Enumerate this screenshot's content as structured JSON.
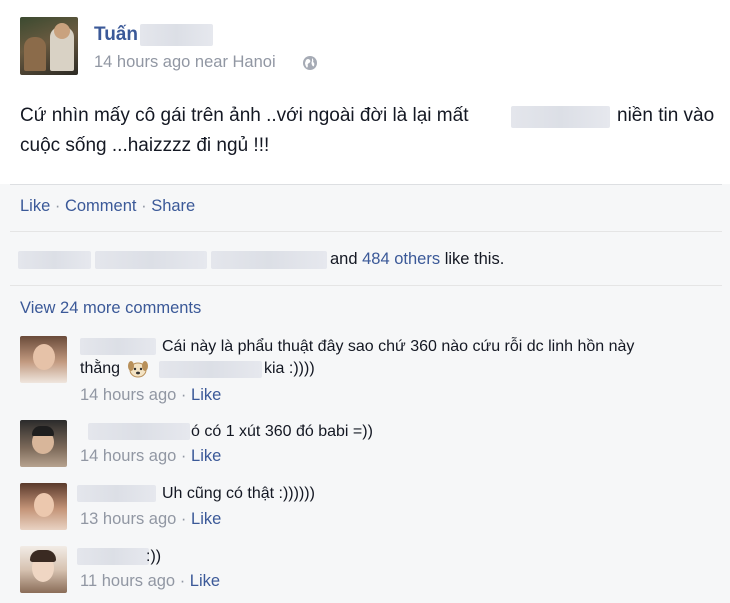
{
  "post": {
    "author_name": "Tuấn",
    "timestamp": "14 hours ago near Hanoi",
    "text_part1": "Cứ nhìn mấy cô gái trên ảnh ..với ngoài đời là lại mất",
    "text_part2": "niền tin vào",
    "text_line2": "cuộc sống ...haizzzz đi ngủ !!!"
  },
  "actions": {
    "like": "Like",
    "comment": "Comment",
    "share": "Share",
    "dot": "·"
  },
  "likes": {
    "and": "and",
    "others": "484 others",
    "suffix": "like this."
  },
  "view_more": "View 24 more comments",
  "comments": [
    {
      "line1": "Cái này là phẩu thuật đây sao chứ 360 nào cứu rỗi dc linh hồn này",
      "line2_a": "thằng",
      "line2_b": "kia :))))",
      "time": "14 hours ago",
      "like": "Like"
    },
    {
      "text": "ó có 1 xút 360 đó babi =))",
      "time": "14 hours ago",
      "like": "Like"
    },
    {
      "text": "Uh cũng có thật :))))))",
      "time": "13 hours ago",
      "like": "Like"
    },
    {
      "text": ":))",
      "time": "11 hours ago",
      "like": "Like"
    }
  ],
  "colors": {
    "link": "#3b5998",
    "meta": "#9197a3",
    "footer_bg": "#f6f7f8"
  },
  "icons": [
    "globe-icon",
    "dog-emoticon-icon"
  ]
}
